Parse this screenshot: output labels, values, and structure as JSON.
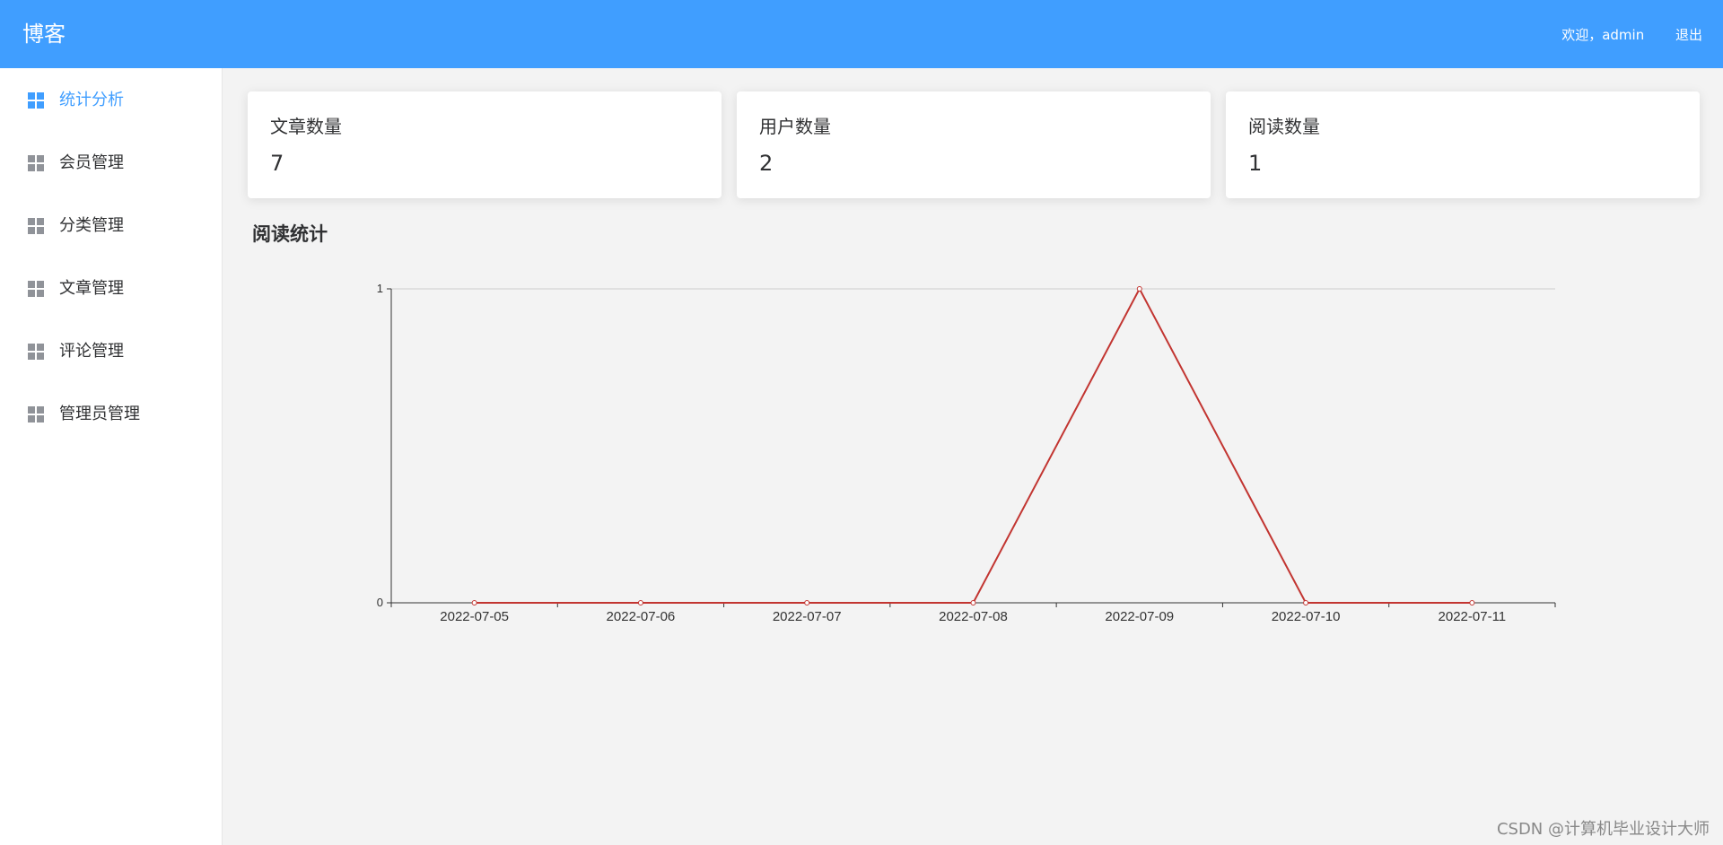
{
  "header": {
    "brand": "博客",
    "welcome": "欢迎，admin",
    "logout": "退出",
    "bg_color": "#409eff"
  },
  "sidebar": {
    "items": [
      {
        "label": "统计分析",
        "icon": "grid-icon",
        "active": true
      },
      {
        "label": "会员管理",
        "icon": "grid-icon",
        "active": false
      },
      {
        "label": "分类管理",
        "icon": "grid-icon",
        "active": false
      },
      {
        "label": "文章管理",
        "icon": "grid-icon",
        "active": false
      },
      {
        "label": "评论管理",
        "icon": "grid-icon",
        "active": false
      },
      {
        "label": "管理员管理",
        "icon": "grid-icon",
        "active": false
      }
    ]
  },
  "stats": [
    {
      "label": "文章数量",
      "value": "7"
    },
    {
      "label": "用户数量",
      "value": "2"
    },
    {
      "label": "阅读数量",
      "value": "1"
    }
  ],
  "section": {
    "title": "阅读统计"
  },
  "chart_data": {
    "type": "line",
    "categories": [
      "2022-07-05",
      "2022-07-06",
      "2022-07-07",
      "2022-07-08",
      "2022-07-09",
      "2022-07-10",
      "2022-07-11"
    ],
    "series": [
      {
        "values": [
          0,
          0,
          0,
          0,
          1,
          0,
          0
        ],
        "color": "#c23531"
      }
    ],
    "ylim": [
      0,
      1
    ],
    "yticks": [
      "0",
      "1"
    ],
    "grid": true,
    "title": "",
    "xlabel": "",
    "ylabel": ""
  },
  "watermark": "CSDN @计算机毕业设计大师"
}
